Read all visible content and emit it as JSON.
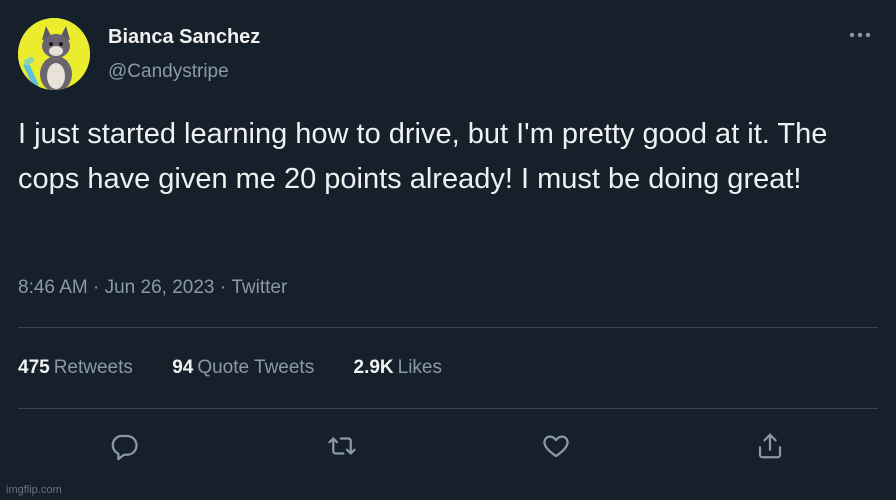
{
  "author": {
    "name": "Bianca Sanchez",
    "handle": "@Candystripe"
  },
  "tweet": {
    "text": "I just started learning how to drive, but I'm pretty good at it. The cops have given me 20 points already! I must be doing great!",
    "time": "8:46 AM",
    "separator": " · ",
    "date": "Jun 26, 2023",
    "source": "Twitter"
  },
  "stats": {
    "retweets": {
      "count": "475",
      "label": "Retweets"
    },
    "quote_tweets": {
      "count": "94",
      "label": "Quote Tweets"
    },
    "likes": {
      "count": "2.9K",
      "label": "Likes"
    }
  },
  "icons": {
    "more": "more-horizontal-icon",
    "reply": "reply-icon",
    "retweet": "retweet-icon",
    "like": "heart-icon",
    "share": "share-icon"
  },
  "watermark": "imgflip.com",
  "colors": {
    "background": "#15202b",
    "text": "#eef0f1",
    "secondary": "#8b98a5",
    "divider": "#38444d",
    "avatar_bg": "#ecec2e"
  }
}
